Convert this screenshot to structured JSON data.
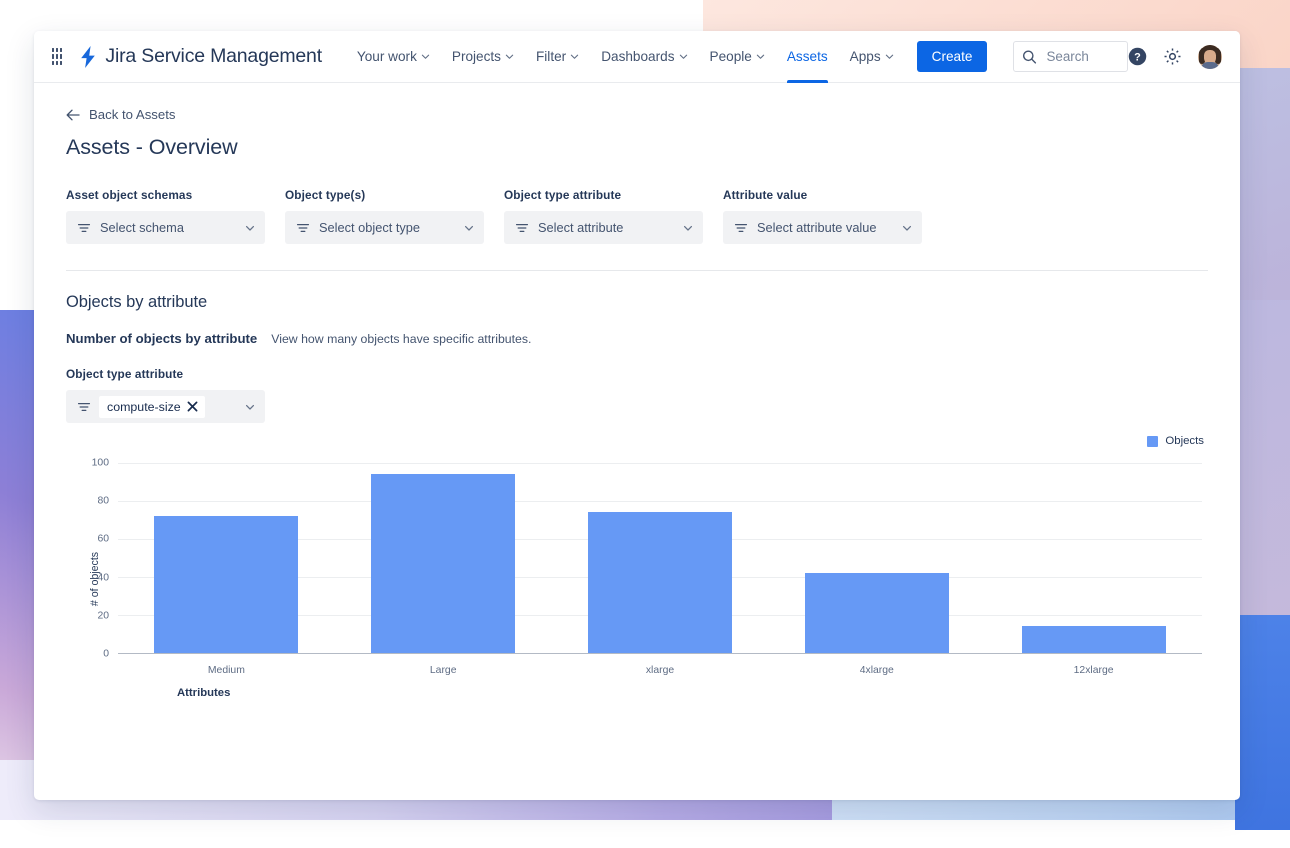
{
  "nav": {
    "app_switcher_icon": "grid-apps-icon",
    "brand": "Jira Service Management",
    "brand_logo_icon": "jira-bolt-icon",
    "links": [
      {
        "label": "Your work",
        "has_caret": true,
        "active": false
      },
      {
        "label": "Projects",
        "has_caret": true,
        "active": false
      },
      {
        "label": "Filter",
        "has_caret": true,
        "active": false
      },
      {
        "label": "Dashboards",
        "has_caret": true,
        "active": false
      },
      {
        "label": "People",
        "has_caret": true,
        "active": false
      },
      {
        "label": "Assets",
        "has_caret": false,
        "active": true
      },
      {
        "label": "Apps",
        "has_caret": true,
        "active": false
      }
    ],
    "create_label": "Create",
    "search_placeholder": "Search",
    "search_value": "",
    "help_icon": "help-circle-icon",
    "settings_icon": "gear-icon",
    "avatar_icon": "user-avatar"
  },
  "page": {
    "back_label": "Back to Assets",
    "back_icon": "arrow-left-icon",
    "title": "Assets - Overview"
  },
  "filters": [
    {
      "label": "Asset object schemas",
      "placeholder": "Select schema"
    },
    {
      "label": "Object type(s)",
      "placeholder": "Select object type"
    },
    {
      "label": "Object type attribute",
      "placeholder": "Select attribute"
    },
    {
      "label": "Attribute value",
      "placeholder": "Select attribute value"
    }
  ],
  "section": {
    "title": "Objects by attribute",
    "subtitle_strong": "Number of objects by attribute",
    "subtitle_desc": "View how many objects have specific attributes.",
    "attribute_picker_label": "Object type attribute",
    "selected_chip": "compute-size",
    "chip_remove_icon": "close-icon"
  },
  "colors": {
    "brand_blue": "#0c66e4",
    "bar_blue": "#6699f5",
    "text_dark": "#253858",
    "text_muted": "#5e6c84"
  },
  "chart_data": {
    "type": "bar",
    "title": "",
    "categories": [
      "Medium",
      "Large",
      "xlarge",
      "4xlarge",
      "12xlarge"
    ],
    "values": [
      72,
      94,
      74,
      42,
      14
    ],
    "series": [
      {
        "name": "Objects",
        "values": [
          72,
          94,
          74,
          42,
          14
        ]
      }
    ],
    "xlabel": "Attributes",
    "ylabel": "# of objects",
    "ylim": [
      0,
      100
    ],
    "yticks": [
      0,
      20,
      40,
      60,
      80,
      100
    ],
    "grid": true,
    "legend": [
      "Objects"
    ],
    "legend_position": "top-right"
  }
}
